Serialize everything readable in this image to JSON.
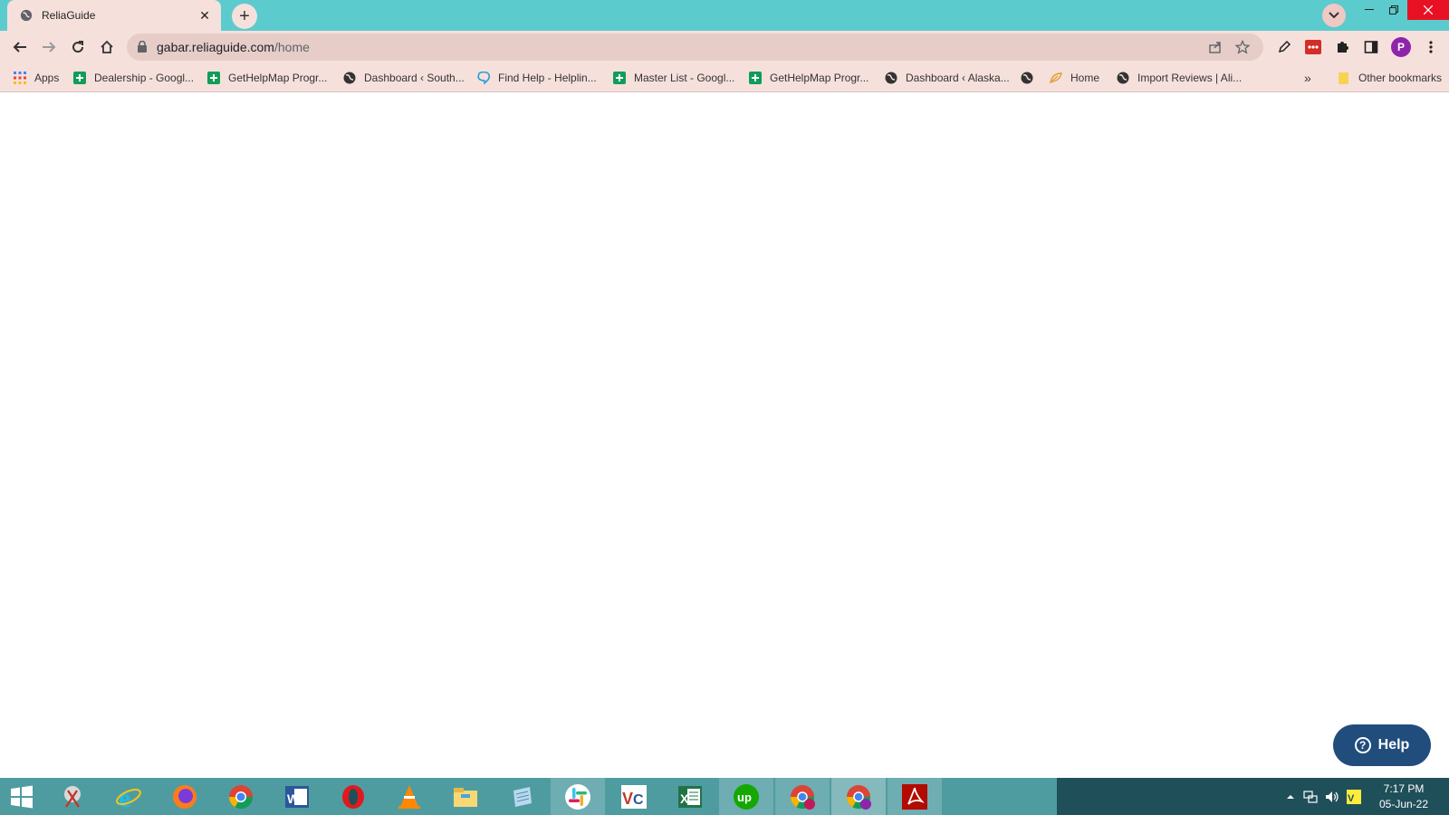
{
  "browser": {
    "tab": {
      "title": "ReliaGuide",
      "favicon": "globe-icon"
    },
    "new_tab_label": "+",
    "address": {
      "host": "gabar.reliaguide.com",
      "path": "/home"
    },
    "profile_initial": "P",
    "accent_colors": {
      "titlebar": "#5ccbce",
      "toolbar": "#f6e0dc",
      "avatar": "#8e24aa"
    }
  },
  "bookmarks": {
    "items": [
      {
        "label": "Apps",
        "icon": "apps-grid-icon"
      },
      {
        "label": "Dealership - Googl...",
        "icon": "sheets-icon"
      },
      {
        "label": "GetHelpMap Progr...",
        "icon": "sheets-icon"
      },
      {
        "label": "Dashboard ‹ South...",
        "icon": "globe-icon"
      },
      {
        "label": "Find Help - Helplin...",
        "icon": "chat-icon"
      },
      {
        "label": "Master List - Googl...",
        "icon": "sheets-icon"
      },
      {
        "label": "GetHelpMap Progr...",
        "icon": "sheets-icon"
      },
      {
        "label": "Dashboard ‹ Alaska...",
        "icon": "globe-icon"
      },
      {
        "label": "",
        "icon": "globe-icon"
      },
      {
        "label": "Home",
        "icon": "leaf-icon"
      },
      {
        "label": "Import Reviews | Ali...",
        "icon": "globe-icon"
      }
    ],
    "overflow_label": "»",
    "other_label": "Other bookmarks"
  },
  "help_widget": {
    "label": "Help",
    "color": "#214d7d"
  },
  "taskbar": {
    "apps": [
      "windows-start-icon",
      "snipping-tool-icon",
      "internet-explorer-icon",
      "firefox-icon",
      "chrome-icon",
      "word-icon",
      "opera-icon",
      "vlc-icon",
      "file-explorer-icon",
      "notepad-icon",
      "slack-icon",
      "vc-app-icon",
      "excel-icon",
      "upwork-icon",
      "chrome-profile-r-icon",
      "chrome-profile-p-icon",
      "acrobat-icon"
    ],
    "clock": {
      "time": "7:17 PM",
      "date": "05-Jun-22"
    }
  }
}
